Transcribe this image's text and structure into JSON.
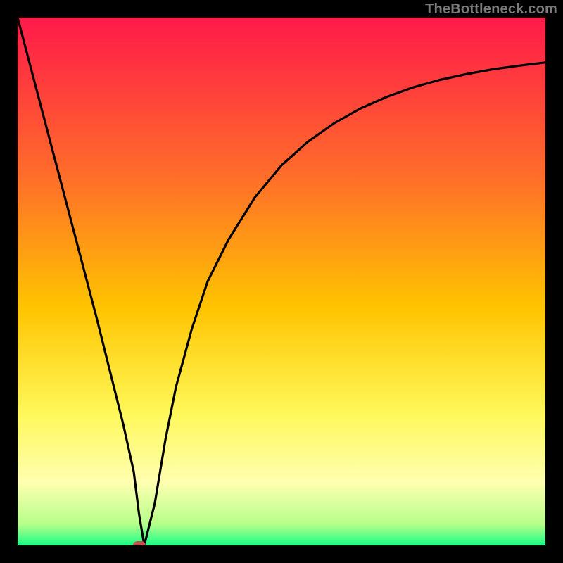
{
  "watermark": "TheBottleneck.com",
  "chart_data": {
    "type": "line",
    "title": "",
    "xlabel": "",
    "ylabel": "",
    "xlim": [
      0,
      100
    ],
    "ylim": [
      0,
      100
    ],
    "grid": false,
    "gradient_stops": [
      {
        "offset": 0.0,
        "color": "#ff1a4a"
      },
      {
        "offset": 0.3,
        "color": "#ff6d2a"
      },
      {
        "offset": 0.55,
        "color": "#ffc400"
      },
      {
        "offset": 0.75,
        "color": "#fff85a"
      },
      {
        "offset": 0.88,
        "color": "#ffffb0"
      },
      {
        "offset": 0.96,
        "color": "#b6ff8a"
      },
      {
        "offset": 1.0,
        "color": "#18ff87"
      }
    ],
    "series": [
      {
        "name": "bottleneck-curve",
        "stroke": "#000000",
        "x": [
          0,
          5,
          10,
          15,
          20,
          22,
          23,
          24,
          26,
          28,
          30,
          33,
          36,
          40,
          45,
          50,
          55,
          60,
          65,
          70,
          75,
          80,
          85,
          90,
          95,
          100
        ],
        "y": [
          100,
          81,
          62,
          43,
          23,
          14,
          6,
          0,
          8,
          20,
          30,
          41,
          50,
          58,
          66,
          72,
          76.5,
          80,
          82.8,
          85,
          86.8,
          88.2,
          89.3,
          90.2,
          90.9,
          91.5
        ]
      }
    ],
    "marker": {
      "x": 23,
      "y": 0,
      "color": "#c0504d"
    }
  }
}
